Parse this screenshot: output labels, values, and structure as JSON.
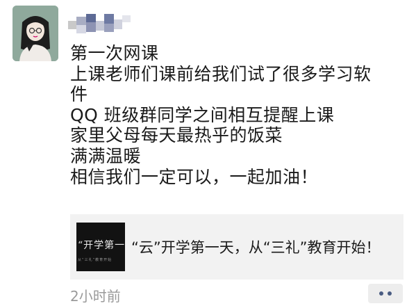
{
  "post": {
    "lines": [
      "第一次网课",
      "上课老师们课前给我们试了很多学习软",
      "件",
      "QQ 班级群同学之间相互提醒上课",
      "家里父母每天最热乎的饭菜",
      "满满温暖",
      "相信我们一定可以，一起加油！"
    ]
  },
  "link": {
    "title": "“云”开学第一天，从“三礼”教育开始！",
    "thumb_title": "“开学第一",
    "thumb_subtitle": "从“三礼”教育开始"
  },
  "time": "2小时前",
  "icons": {
    "avatar": "avatar-icon",
    "more": "more-dots-icon"
  }
}
